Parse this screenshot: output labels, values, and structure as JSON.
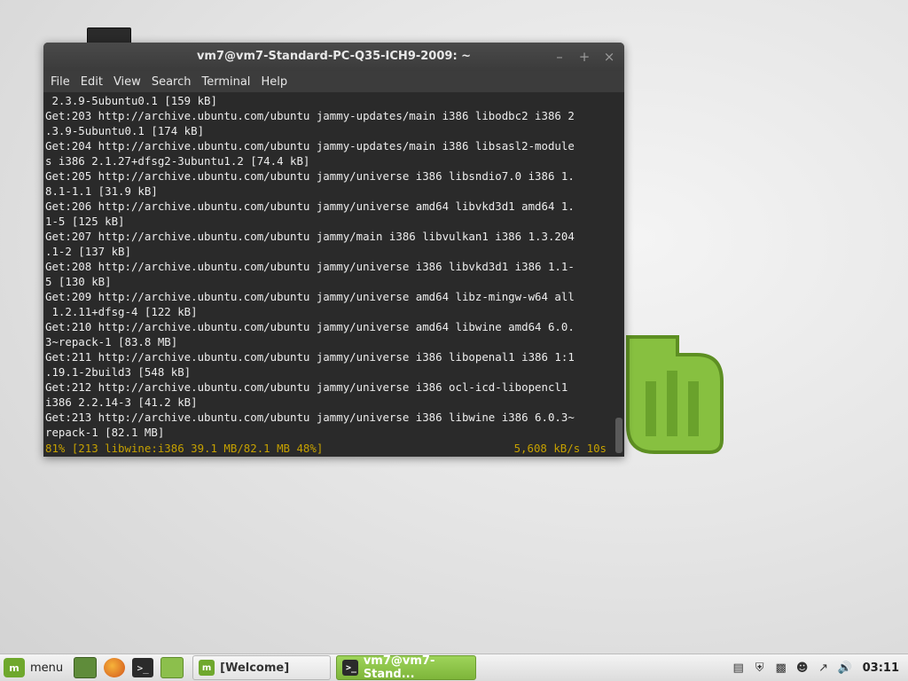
{
  "window": {
    "title": "vm7@vm7-Standard-PC-Q35-ICH9-2009: ~",
    "controls": [
      "minimize-icon",
      "maximize-icon",
      "close-icon"
    ]
  },
  "menubar": [
    "File",
    "Edit",
    "View",
    "Search",
    "Terminal",
    "Help"
  ],
  "terminal": {
    "lines": [
      " 2.3.9-5ubuntu0.1 [159 kB]",
      "Get:203 http://archive.ubuntu.com/ubuntu jammy-updates/main i386 libodbc2 i386 2",
      ".3.9-5ubuntu0.1 [174 kB]",
      "Get:204 http://archive.ubuntu.com/ubuntu jammy-updates/main i386 libsasl2-module",
      "s i386 2.1.27+dfsg2-3ubuntu1.2 [74.4 kB]",
      "Get:205 http://archive.ubuntu.com/ubuntu jammy/universe i386 libsndio7.0 i386 1.",
      "8.1-1.1 [31.9 kB]",
      "Get:206 http://archive.ubuntu.com/ubuntu jammy/universe amd64 libvkd3d1 amd64 1.",
      "1-5 [125 kB]",
      "Get:207 http://archive.ubuntu.com/ubuntu jammy/main i386 libvulkan1 i386 1.3.204",
      ".1-2 [137 kB]",
      "Get:208 http://archive.ubuntu.com/ubuntu jammy/universe i386 libvkd3d1 i386 1.1-",
      "5 [130 kB]",
      "Get:209 http://archive.ubuntu.com/ubuntu jammy/universe amd64 libz-mingw-w64 all",
      " 1.2.11+dfsg-4 [122 kB]",
      "Get:210 http://archive.ubuntu.com/ubuntu jammy/universe amd64 libwine amd64 6.0.",
      "3~repack-1 [83.8 MB]",
      "Get:211 http://archive.ubuntu.com/ubuntu jammy/universe i386 libopenal1 i386 1:1",
      ".19.1-2build3 [548 kB]",
      "Get:212 http://archive.ubuntu.com/ubuntu jammy/universe i386 ocl-icd-libopencl1",
      "i386 2.2.14-3 [41.2 kB]",
      "Get:213 http://archive.ubuntu.com/ubuntu jammy/universe i386 libwine i386 6.0.3~",
      "repack-1 [82.1 MB]"
    ],
    "status_left": "81% [213 libwine:i386 39.1 MB/82.1 MB 48%]",
    "status_right": "5,608 kB/s 10s",
    "status_color": "#c5a000"
  },
  "taskbar": {
    "menu_label": "menu",
    "launchers": [
      "show-desktop-icon",
      "firefox-icon",
      "terminal-icon",
      "files-icon"
    ],
    "tasks": [
      {
        "label": "[Welcome]",
        "icon": "mint-icon",
        "active": false
      },
      {
        "label": "vm7@vm7-Stand...",
        "icon": "terminal-icon",
        "active": true
      }
    ],
    "tray": [
      "clipboard-icon",
      "shield-icon",
      "display-icon",
      "user-icon",
      "network-icon",
      "volume-icon"
    ],
    "clock": "03:11"
  },
  "colors": {
    "accent": "#7eb53a",
    "terminal_bg": "#2a2a2a",
    "titlebar": "#3b3b3b"
  }
}
